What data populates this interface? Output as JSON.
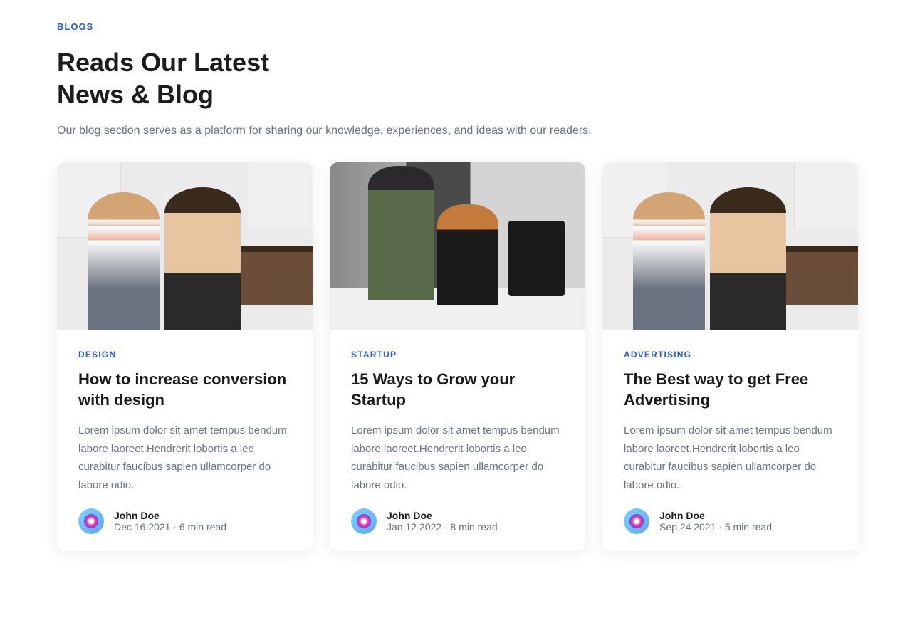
{
  "header": {
    "label": "BLOGS",
    "title_line1": "Reads Our Latest",
    "title_line2": "News & Blog",
    "subtitle": "Our blog section serves as a platform for sharing our knowledge, experiences, and ideas with our readers."
  },
  "cards": [
    {
      "category": "DESIGN",
      "title": "How to increase conversion with design",
      "description": "Lorem ipsum dolor sit amet tempus bendum labore laoreet.Hendrerit lobortis a leo curabitur faucibus sapien ullamcorper do labore odio.",
      "author": "John Doe",
      "meta": "Dec 16 2021 · 6 min read",
      "image_type": "kitchen"
    },
    {
      "category": "STARTUP",
      "title": "15 Ways to Grow your Startup",
      "description": "Lorem ipsum dolor sit amet tempus bendum labore laoreet.Hendrerit lobortis a leo curabitur faucibus sapien ullamcorper do labore odio.",
      "author": "John Doe",
      "meta": "Jan 12 2022 · 8 min read",
      "image_type": "office"
    },
    {
      "category": "ADVERTISING",
      "title": "The Best way to get Free Advertising",
      "description": "Lorem ipsum dolor sit amet tempus bendum labore laoreet.Hendrerit lobortis a leo curabitur faucibus sapien ullamcorper do labore odio.",
      "author": "John Doe",
      "meta": "Sep 24 2021 · 5 min read",
      "image_type": "kitchen"
    }
  ]
}
